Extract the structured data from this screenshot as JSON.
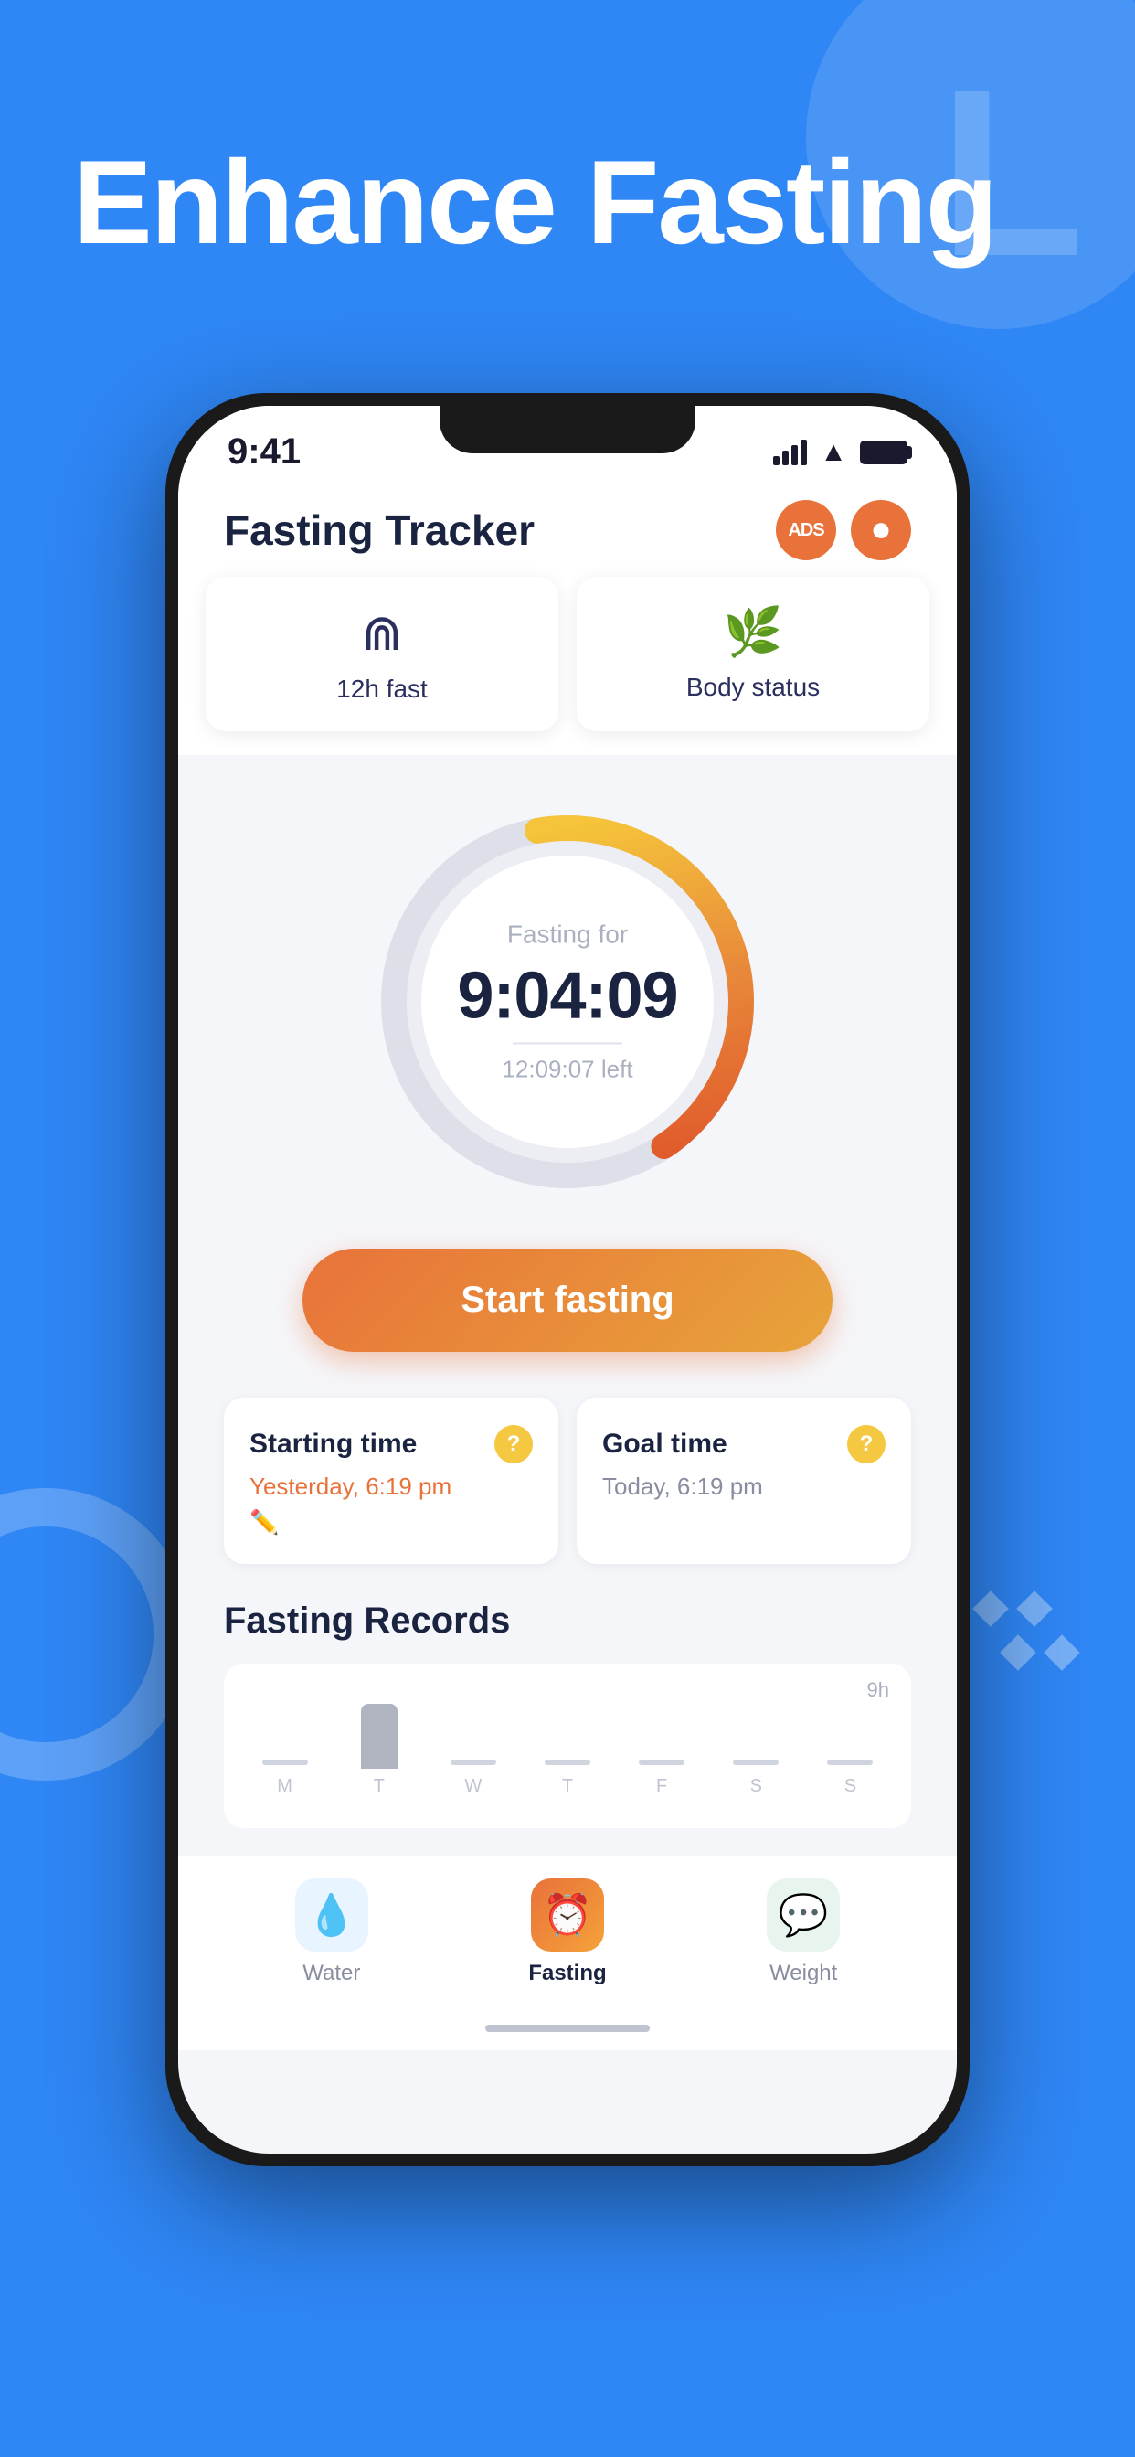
{
  "background_color": "#2f86f5",
  "hero": {
    "title": "Enhance Fasting",
    "letter_decoration": "L"
  },
  "status_bar": {
    "time": "9:41"
  },
  "app": {
    "title": "Fasting Tracker",
    "header_icon_ads": "ADS",
    "header_icon_record": "⏺"
  },
  "tabs": [
    {
      "label": "12h fast",
      "icon": "⋈"
    },
    {
      "label": "Body status",
      "icon": "🌿"
    }
  ],
  "timer": {
    "label": "Fasting for",
    "value": "9:04:09",
    "remaining": "12:09:07 left",
    "progress_pct": 43
  },
  "start_button": {
    "label": "Start fasting"
  },
  "time_cards": [
    {
      "title": "Starting time",
      "value": "Yesterday, 6:19 pm",
      "has_edit": true
    },
    {
      "title": "Goal time",
      "value": "Today, 6:19 pm",
      "has_edit": false
    }
  ],
  "records": {
    "title": "Fasting Records",
    "chart_label": "9h",
    "bars": [
      {
        "label": "M",
        "height": 0,
        "color": "#e0e2ea"
      },
      {
        "label": "T",
        "height": 80,
        "color": "#c0c4d0"
      },
      {
        "label": "W",
        "height": 0,
        "color": "#e0e2ea"
      },
      {
        "label": "T",
        "height": 0,
        "color": "#e0e2ea"
      },
      {
        "label": "F",
        "height": 0,
        "color": "#e0e2ea"
      },
      {
        "label": "S",
        "height": 0,
        "color": "#e0e2ea"
      },
      {
        "label": "S",
        "height": 0,
        "color": "#e0e2ea"
      }
    ]
  },
  "bottom_nav": [
    {
      "label": "Water",
      "active": false,
      "icon": "💧"
    },
    {
      "label": "Fasting",
      "active": true,
      "icon": "⏰"
    },
    {
      "label": "Weight",
      "active": false,
      "icon": "💬"
    }
  ]
}
